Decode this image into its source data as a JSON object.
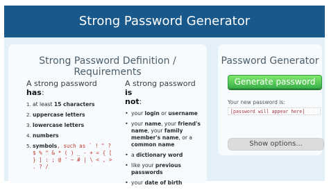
{
  "header": {
    "title": "Strong Password Generator"
  },
  "requirements": {
    "title": "Strong Password Definition / Requirements",
    "has": {
      "intro_prefix": "A strong password",
      "intro_bold": "has",
      "intro_suffix": ":",
      "items": [
        {
          "pre": "at least ",
          "bold": "15 characters",
          "post": ""
        },
        {
          "pre": "",
          "bold": "uppercase letters",
          "post": ""
        },
        {
          "pre": "",
          "bold": "lowercase letters",
          "post": ""
        },
        {
          "pre": "",
          "bold": "numbers",
          "post": ""
        },
        {
          "pre": "",
          "bold": "symbols",
          "post": ", such as ` ! \" ? $ % ^ & * ( ) _ - + = { [ } ] : ; @ ' ~ # | \\ < , > . ? /"
        }
      ]
    },
    "not": {
      "intro_prefix": "A strong password",
      "intro_bold1": "is",
      "intro_bold2": "not",
      "intro_suffix": ":",
      "items": [
        {
          "pre": "your ",
          "bold": "login",
          "mid": " or ",
          "bold2": "username",
          "post": ""
        },
        {
          "pre": "your ",
          "bold": "name",
          "mid": ", your ",
          "bold2": "friend's name",
          "post": ", your ",
          "bold3": "family member's name",
          "post2": ", or a ",
          "bold4": "common name"
        },
        {
          "pre": "a ",
          "bold": "dictionary word",
          "post": ""
        },
        {
          "pre": "like your ",
          "bold": "previous passwords",
          "post": ""
        },
        {
          "pre": "your ",
          "bold": "date of birth",
          "post": ""
        }
      ]
    }
  },
  "generator": {
    "title": "Password Generator",
    "generate_label": "Generate password",
    "new_password_label": "Your new password is:",
    "password_placeholder": "[password will appear here]",
    "show_options_label": "Show options..."
  }
}
